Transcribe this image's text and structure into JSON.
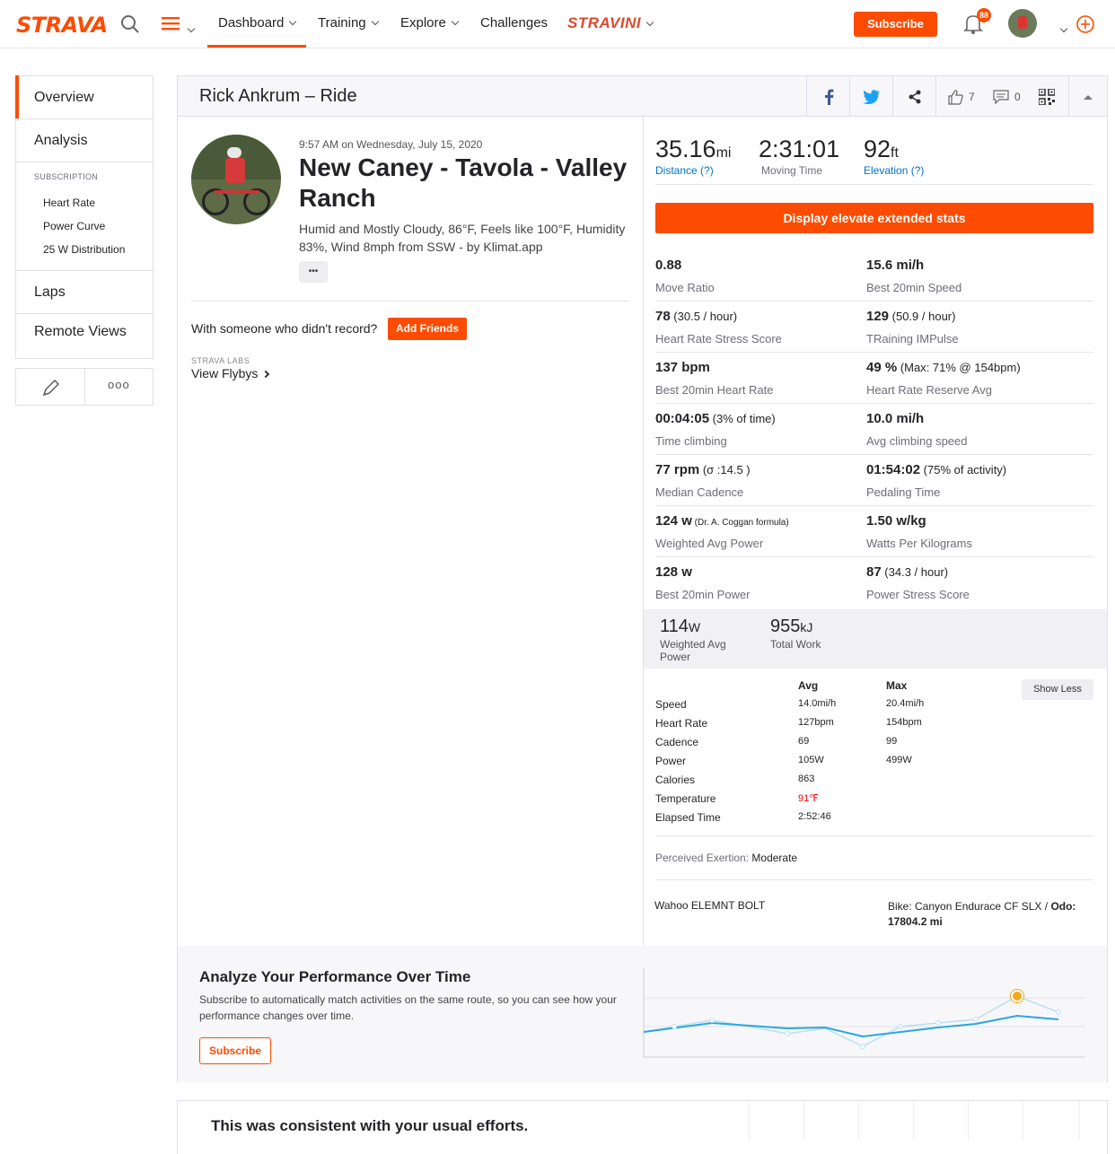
{
  "nav": {
    "logo": "STRAVA",
    "dashboard": "Dashboard",
    "training": "Training",
    "explore": "Explore",
    "challenges": "Challenges",
    "stravini": "STRAVINI",
    "subscribe": "Subscribe",
    "notif_count": "88",
    "accent": "#fc4c02"
  },
  "sidebar": {
    "overview": "Overview",
    "analysis": "Analysis",
    "subscription_heading": "SUBSCRIPTION",
    "heart_rate": "Heart Rate",
    "power_curve": "Power Curve",
    "distribution": "25 W Distribution",
    "laps": "Laps",
    "remote_views": "Remote Views",
    "more": "ooo"
  },
  "header": {
    "title": "Rick Ankrum – Ride",
    "kudos": "7",
    "comments": "0"
  },
  "activity": {
    "datetime": "9:57 AM on Wednesday, July 15, 2020",
    "name": "New Caney - Tavola - Valley Ranch",
    "description": "Humid and Mostly Cloudy, 86°F, Feels like 100°F, Humidity 83%, Wind 8mph from SSW - by Klimat.app",
    "dots": "•••",
    "friends_prompt": "With someone who didn't record?",
    "add_friends": "Add Friends",
    "labs": "STRAVA LABS",
    "flybys": "View Flybys"
  },
  "primary_stats": {
    "distance_value": "35.16",
    "distance_unit": "mi",
    "distance_label": "Distance (?)",
    "time_value": "2:31:01",
    "time_label": "Moving Time",
    "elev_value": "92",
    "elev_unit": "ft",
    "elev_label": "Elevation (?)"
  },
  "elevate_button": "Display elevate extended stats",
  "elevate": [
    {
      "value": "0.88",
      "extra": "",
      "label": "Move Ratio"
    },
    {
      "value": "15.6 mi/h",
      "extra": "",
      "label": "Best 20min Speed"
    },
    {
      "value": "78",
      "extra": " (30.5 / hour)",
      "label": "Heart Rate Stress Score"
    },
    {
      "value": "129",
      "extra": " (50.9 / hour)",
      "label": "TRaining IMPulse"
    },
    {
      "value": "137 bpm",
      "extra": "",
      "label": "Best 20min Heart Rate"
    },
    {
      "value": "49 %",
      "extra": " (Max: 71% @ 154bpm)",
      "label": "Heart Rate Reserve Avg"
    },
    {
      "value": "00:04:05",
      "extra": " (3% of time)",
      "label": "Time climbing"
    },
    {
      "value": "10.0 mi/h",
      "extra": "",
      "label": "Avg climbing speed"
    },
    {
      "value": "77 rpm",
      "extra": " (σ :14.5 )",
      "label": "Median Cadence"
    },
    {
      "value": "01:54:02",
      "extra": " (75% of activity)",
      "label": "Pedaling Time"
    },
    {
      "value": "124 w",
      "extra": " (Dr. A. Coggan formula)",
      "label": "Weighted Avg Power"
    },
    {
      "value": "1.50 w/kg",
      "extra": "",
      "label": "Watts Per Kilograms"
    },
    {
      "value": "128 w",
      "extra": "",
      "label": "Best 20min Power"
    },
    {
      "value": "87",
      "extra": " (34.3 / hour)",
      "label": "Power Stress Score"
    }
  ],
  "secondary_stats": {
    "wap_value": "114",
    "wap_unit": "W",
    "wap_label": "Weighted Avg Power",
    "work_value": "955",
    "work_unit": "kJ",
    "work_label": "Total Work"
  },
  "table": {
    "avg_head": "Avg",
    "max_head": "Max",
    "show_less": "Show Less",
    "rows": [
      {
        "label": "Speed",
        "avg": "14.0mi/h",
        "max": "20.4mi/h"
      },
      {
        "label": "Heart Rate",
        "avg": "127bpm",
        "max": "154bpm"
      },
      {
        "label": "Cadence",
        "avg": "69",
        "max": "99"
      },
      {
        "label": "Power",
        "avg": "105W",
        "max": "499W"
      },
      {
        "label": "Calories",
        "avg": "863",
        "max": ""
      },
      {
        "label": "Temperature",
        "avg": "91℉",
        "max": ""
      },
      {
        "label": "Elapsed Time",
        "avg": "2:52:46",
        "max": ""
      }
    ]
  },
  "exertion": {
    "label": "Perceived Exertion:",
    "value": "Moderate"
  },
  "device": "Wahoo ELEMNT BOLT",
  "bike": {
    "prefix": "Bike: Canyon Endurace CF SLX / ",
    "odo_label": "Odo:",
    "odo_value": "17804.2 mi"
  },
  "promo": {
    "title": "Analyze Your Performance Over Time",
    "text": "Subscribe to automatically match activities on the same route, so you can see how your performance changes over time.",
    "button": "Subscribe"
  },
  "consistent": {
    "title": "This was consistent with your usual efforts."
  }
}
